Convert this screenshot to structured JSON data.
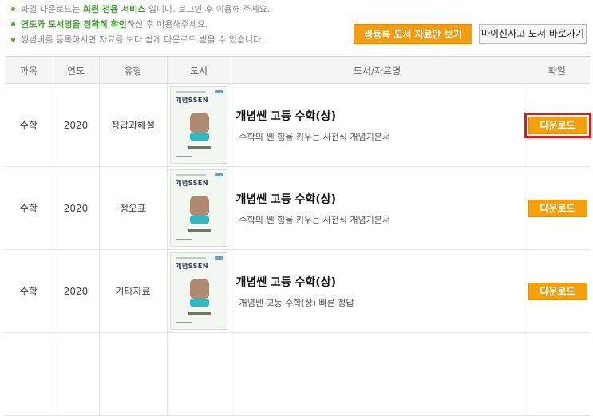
{
  "notices": [
    {
      "parts": [
        {
          "t": "파일 다운로드는 ",
          "em": false
        },
        {
          "t": "회원 전용 서비스",
          "em": true
        },
        {
          "t": " 입니다. 로그인 후 이용해 주세요.",
          "em": false
        }
      ]
    },
    {
      "parts": [
        {
          "t": "연도와 도서명을 정확히 확인",
          "em": true
        },
        {
          "t": "하신 후 이용해주세요.",
          "em": false
        }
      ]
    },
    {
      "parts": [
        {
          "t": "씽넘버를 등록하시면 자료를 보다 쉽게 다운로드 받을 수 있습니다.",
          "em": false
        }
      ]
    }
  ],
  "buttons": {
    "registered_only": "씽등록 도서 자료만 보기",
    "my_books": "마이신사고 도서 바로가기"
  },
  "table": {
    "headers": {
      "subject": "과목",
      "year": "연도",
      "type": "유형",
      "book": "도서",
      "title": "도서/자료명",
      "file": "파일"
    },
    "rows": [
      {
        "subject": "수학",
        "year": "2020",
        "type": "정답과해설",
        "title": "개념쎈 고등 수학(상)",
        "desc": "수학의 쎈 힘을 키우는 사전식 개념기본서",
        "download": "다운로드",
        "highlighted": true
      },
      {
        "subject": "수학",
        "year": "2020",
        "type": "정오표",
        "title": "개념쎈 고등 수학(상)",
        "desc": "수학의 쎈 힘을 키우는 사전식 개념기본서",
        "download": "다운로드",
        "highlighted": false
      },
      {
        "subject": "수학",
        "year": "2020",
        "type": "기타자료",
        "title": "개념쎈 고등 수학(상)",
        "desc": "개념쎈 고등 수학(상) 빠른 정답",
        "download": "다운로드",
        "highlighted": false
      }
    ]
  },
  "book_cover": {
    "brand": "개념SSEN"
  },
  "colors": {
    "accent_orange": "#f5a00a",
    "notice_green": "#4aa33a",
    "highlight_red": "#e0191d"
  }
}
